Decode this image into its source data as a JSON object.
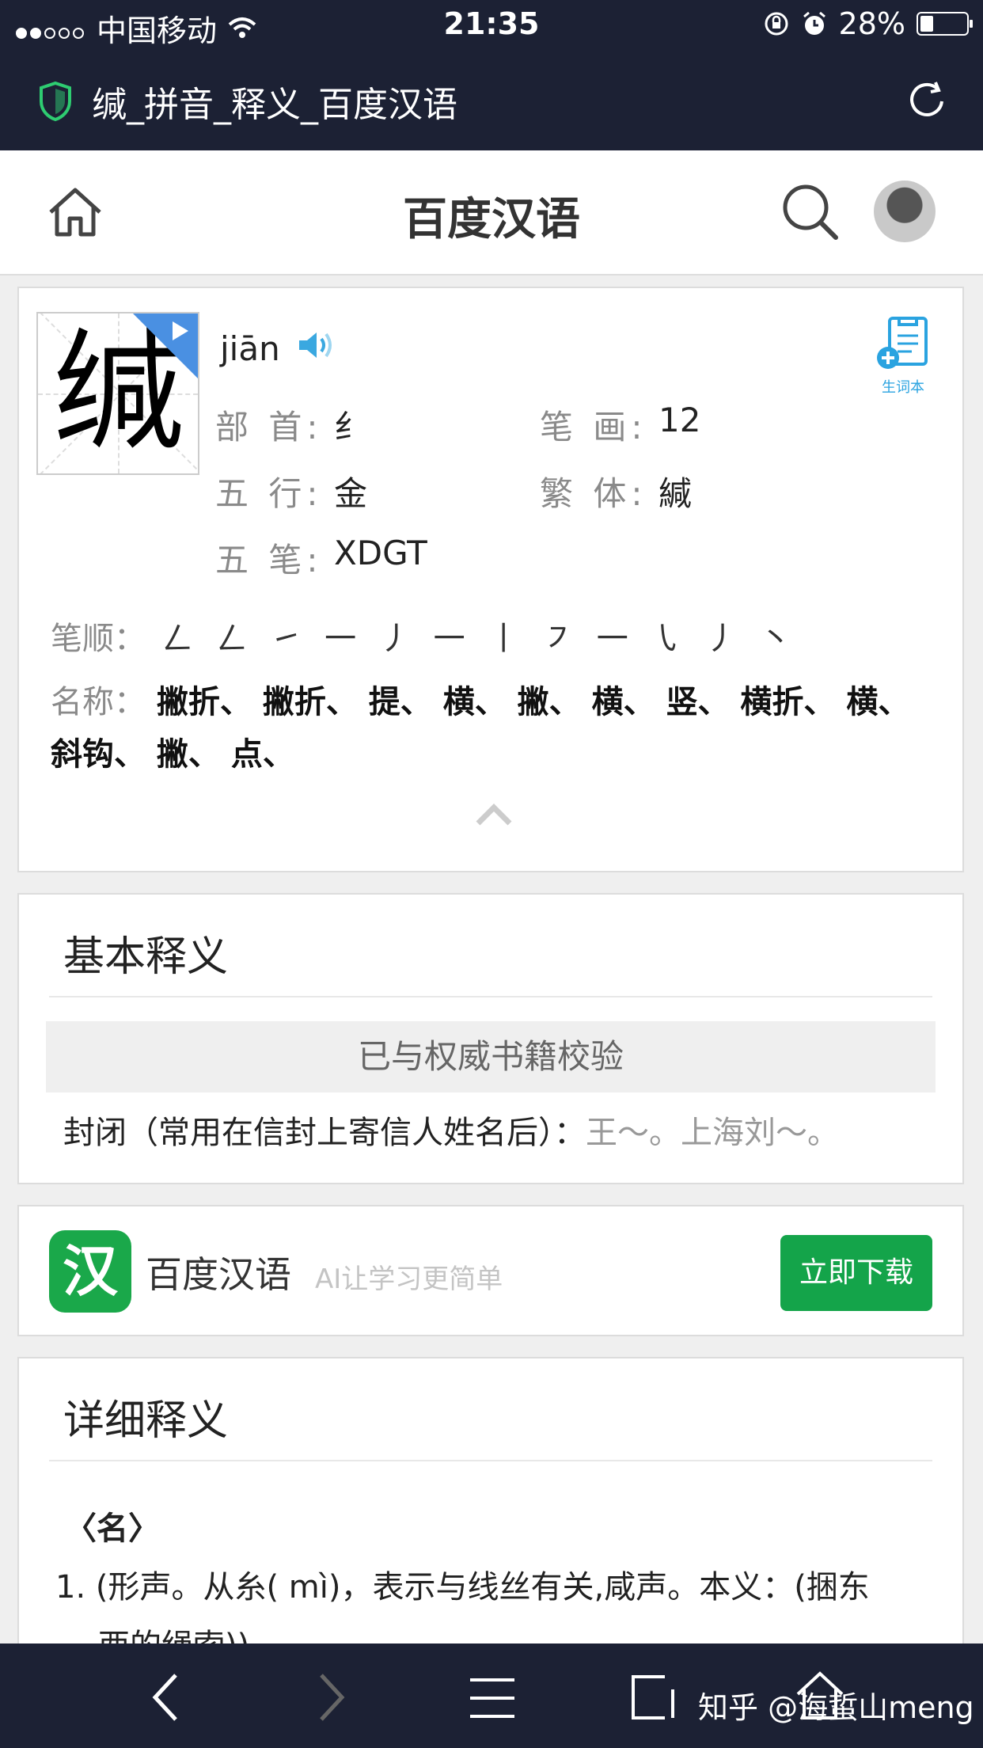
{
  "status_bar": {
    "carrier": "中国移动",
    "time": "21:35",
    "battery": "28%",
    "battery_level": 0.28
  },
  "browser": {
    "page_title": "缄_拼音_释义_百度汉语"
  },
  "header": {
    "site_name": "百度汉语"
  },
  "word": {
    "character": "缄",
    "pinyin": "jiān",
    "vocab_label": "生词本",
    "radical_label": "部 首:",
    "radical": "纟",
    "strokes_label": "笔 画:",
    "strokes": "12",
    "wuxing_label": "五 行:",
    "wuxing": "金",
    "traditional_label": "繁 体:",
    "traditional": "緘",
    "wubi_label": "五 笔:",
    "wubi": "XDGT",
    "stroke_order_label": "笔顺：",
    "stroke_order": "ㄥ ㄥ ㇀ 一 丿 一 丨 ㇇ 一 ㇂ 丿 丶",
    "stroke_names_label": "名称：",
    "stroke_names": "撇折、 撇折、 提、 横、 撇、 横、 竖、 横折、 横、 斜钩、 撇、 点、"
  },
  "basic": {
    "title": "基本释义",
    "verified": "已与权威书籍校验",
    "definition": "封闭（常用在信封上寄信人姓名后）：",
    "example": "王～。上海刘～。"
  },
  "app_promo": {
    "logo_char": "汉",
    "name": "百度汉语",
    "slogan": "AI让学习更简单",
    "download": "立即下载"
  },
  "detailed": {
    "title": "详细释义",
    "pos": "〈名〉",
    "item1_line1": "1.  (形声。从糸( mì)，表示与线丝有关,咸声。本义：(捆东",
    "item1_line2": "西的绳索))"
  },
  "watermark": "知乎 @海蜇山meng"
}
